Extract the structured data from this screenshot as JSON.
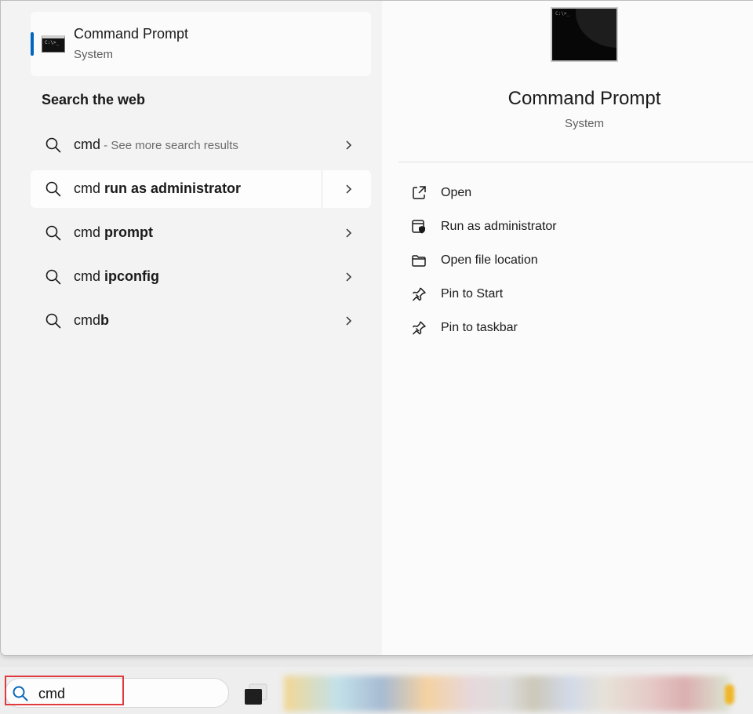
{
  "best_match": {
    "title": "Command Prompt",
    "subtitle": "System",
    "icon": "command-prompt-icon"
  },
  "search_web": {
    "heading": "Search the web",
    "results": [
      {
        "prefix": "cmd",
        "bold": "",
        "hint": " - See more search results"
      },
      {
        "prefix": "cmd ",
        "bold": "run as administrator",
        "hint": ""
      },
      {
        "prefix": "cmd ",
        "bold": "prompt",
        "hint": ""
      },
      {
        "prefix": "cmd ",
        "bold": "ipconfig",
        "hint": ""
      },
      {
        "prefix": "cmd",
        "bold": "b",
        "hint": ""
      }
    ]
  },
  "details": {
    "app_name": "Command Prompt",
    "app_kind": "System",
    "actions": [
      {
        "label": "Open",
        "icon": "open-external-icon"
      },
      {
        "label": "Run as administrator",
        "icon": "shield-admin-icon"
      },
      {
        "label": "Open file location",
        "icon": "folder-icon"
      },
      {
        "label": "Pin to Start",
        "icon": "pin-icon"
      },
      {
        "label": "Pin to taskbar",
        "icon": "pin-icon"
      }
    ]
  },
  "taskbar": {
    "search_value": "cmd"
  },
  "colors": {
    "accent": "#0067c0",
    "highlight_frame": "#e0393e"
  }
}
